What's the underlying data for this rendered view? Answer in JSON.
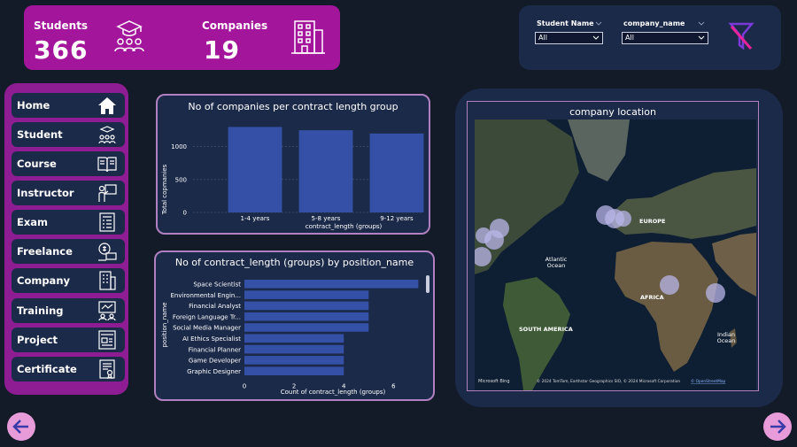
{
  "kpis": {
    "students_label": "Students",
    "students_value": "366",
    "companies_label": "Companies",
    "companies_value": "19"
  },
  "filters": {
    "student_name_label": "Student Name",
    "student_name_value": "All",
    "company_name_label": "company_name",
    "company_name_value": "All"
  },
  "nav": {
    "items": [
      {
        "label": "Home",
        "icon": "home-icon"
      },
      {
        "label": "Student",
        "icon": "student-icon"
      },
      {
        "label": "Course",
        "icon": "book-icon"
      },
      {
        "label": "Instructor",
        "icon": "instructor-icon"
      },
      {
        "label": "Exam",
        "icon": "exam-icon"
      },
      {
        "label": "Freelance",
        "icon": "freelance-icon"
      },
      {
        "label": "Company",
        "icon": "building-icon"
      },
      {
        "label": "Training",
        "icon": "training-icon"
      },
      {
        "label": "Project",
        "icon": "project-icon"
      },
      {
        "label": "Certificate",
        "icon": "certificate-icon"
      }
    ]
  },
  "chart_contract": {
    "title": "No of companies per contract length group",
    "xlabel": "contract_length (groups)",
    "ylabel": "Total copmanies",
    "yticks": [
      "0",
      "500",
      "1000"
    ]
  },
  "chart_position": {
    "title": "No of contract_length (groups) by position_name",
    "xlabel": "Count of contract_length (groups)",
    "ylabel": "position_name",
    "xticks": [
      "0",
      "2",
      "4",
      "6"
    ]
  },
  "map": {
    "title": "company location",
    "labels": {
      "europe": "EUROPE",
      "atlantic": "Atlantic",
      "atlantic2": "Ocean",
      "africa": "AFRICA",
      "south_america": "SOUTH AMERICA",
      "indian": "Indian",
      "indian2": "Ocean"
    },
    "brand": "Microsoft Bing",
    "attribution": "© 2024 TomTom, Earthstar Geographics SIO, © 2024 Microsoft Corporation",
    "osm_link": "© OpenStreetMap"
  },
  "colors": {
    "kpi_bg": "#a3169b",
    "nav_bg": "#8e1d93",
    "panel_bg": "#1c2a4a",
    "bar": "#3451a7",
    "arrow": "#e79bd9"
  },
  "chart_data": [
    {
      "type": "bar",
      "title": "No of companies per contract length group",
      "categories": [
        "1-4 years",
        "5-8 years",
        "9-12 years"
      ],
      "values": [
        1300,
        1250,
        1200
      ],
      "xlabel": "contract_length (groups)",
      "ylabel": "Total copmanies",
      "ylim": [
        0,
        1400
      ],
      "grid": true
    },
    {
      "type": "bar",
      "orientation": "horizontal",
      "title": "No of contract_length (groups) by position_name",
      "categories": [
        "Space Scientist",
        "Environmental Engin...",
        "Financial Analyst",
        "Foreign Language Tr...",
        "Social Media Manager",
        "AI Ethics Specialist",
        "Financial Planner",
        "Game Developer",
        "Graphic Designer"
      ],
      "values": [
        7,
        5,
        5,
        5,
        5,
        4,
        4,
        4,
        4
      ],
      "xlabel": "Count of contract_length (groups)",
      "ylabel": "position_name",
      "xlim": [
        0,
        7.2
      ]
    }
  ]
}
